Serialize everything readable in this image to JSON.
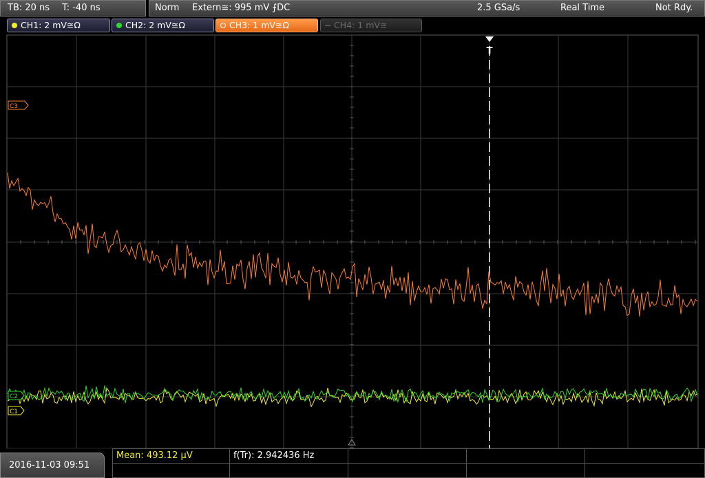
{
  "timebase": {
    "tb": "TB: 20 ns",
    "t": "T: -40 ns"
  },
  "acquisition": {
    "mode": "Norm",
    "trigger": "Extern≅: 995 mV ⨍DC",
    "sample_rate": "2.5 GSa/s",
    "run_mode": "Real Time",
    "status": "Not Rdy."
  },
  "channels": [
    {
      "label": "CH1: 2 mV≅Ω",
      "color": "#f2ee2a",
      "state": "on"
    },
    {
      "label": "CH2: 2 mV≅Ω",
      "color": "#2cd92c",
      "state": "on"
    },
    {
      "label": "CH3: 1 mV≅Ω",
      "color": "#ff7f2a",
      "state": "active"
    },
    {
      "label": "CH4: 1 mV≅",
      "color": "#666666",
      "state": "off"
    }
  ],
  "markers": {
    "ch3": "C3",
    "ch1": "C1",
    "ch2": "C2",
    "trigger": "T"
  },
  "datetime": "2016-11-03 09:51",
  "measurements": {
    "mean": "Mean: 493.12 µV",
    "freq": "f(Tr): 2.942436 Hz"
  },
  "colors": {
    "ch1": "#f2ee2a",
    "ch2": "#2cd92c",
    "ch3": "#ff7f2a",
    "grid": "#3c3c3c",
    "trigger_line": "#ffffff"
  }
}
